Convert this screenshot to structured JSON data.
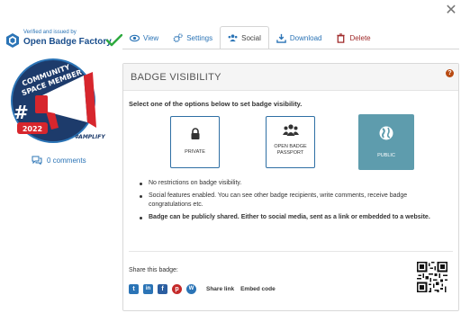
{
  "issuer": {
    "verified_text": "Verified and issued by",
    "name": "Open Badge Factory"
  },
  "badge": {
    "lines": [
      "COMMUNITY",
      "SPACE MEMBER"
    ],
    "year": "2022",
    "hashtag": "#AMPLIFY",
    "comments": "0 comments"
  },
  "tabs": [
    {
      "label": "View",
      "icon": "eye-icon"
    },
    {
      "label": "Settings",
      "icon": "gears-icon"
    },
    {
      "label": "Social",
      "icon": "users-icon",
      "active": true
    },
    {
      "label": "Download",
      "icon": "download-icon"
    },
    {
      "label": "Delete",
      "icon": "trash-icon"
    }
  ],
  "panel": {
    "title": "BADGE VISIBILITY",
    "help_icon": "?",
    "instructions": "Select one of the options below to set badge visibility.",
    "options": [
      {
        "label": "PRIVATE",
        "icon": "lock-icon"
      },
      {
        "label": "OPEN BADGE PASSPORT",
        "icon": "users-icon"
      },
      {
        "label": "PUBLIC",
        "icon": "globe-icon",
        "selected": true
      }
    ],
    "bullets": [
      "No restrictions on badge visibility.",
      "Social features enabled. You can see other badge recipients, write comments, receive badge congratulations etc.",
      "Badge can be publicly shared. Either to social media, sent as a link or embedded to a website."
    ],
    "share": {
      "label": "Share this badge:",
      "networks": [
        "twitter",
        "linkedin",
        "facebook",
        "pinterest",
        "wordpress"
      ],
      "share_link": "Share link",
      "embed_code": "Embed code"
    }
  },
  "colors": {
    "link_blue": "#2b74b6",
    "public_selected": "#5e9cad",
    "delete_red": "#a02a2a",
    "help_orange": "#b84a12"
  }
}
